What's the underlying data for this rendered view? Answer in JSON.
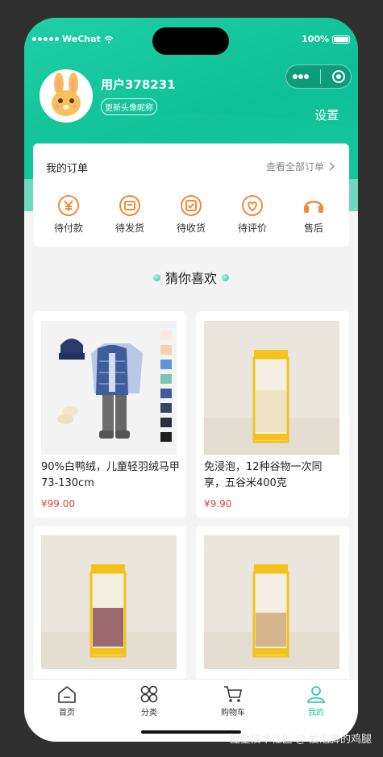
{
  "status_bar": {
    "carrier": "WeChat",
    "battery": "100%"
  },
  "profile": {
    "username": "用户378231",
    "update_label": "更新头像昵称",
    "settings_label": "设置"
  },
  "orders": {
    "title": "我的订单",
    "view_all": "查看全部订单",
    "items": [
      {
        "label": "待付款",
        "icon": "yen-circle-icon"
      },
      {
        "label": "待发货",
        "icon": "shipping-box-icon"
      },
      {
        "label": "待收货",
        "icon": "receive-check-icon"
      },
      {
        "label": "待评价",
        "icon": "heart-comment-icon"
      },
      {
        "label": "售后",
        "icon": "headset-icon"
      }
    ]
  },
  "recommend": {
    "title": "猜你喜欢"
  },
  "products": [
    {
      "title": "90%白鸭绒，儿童轻羽绒马甲73-130cm",
      "price": "¥99.00"
    },
    {
      "title": "免浸泡，12种谷物一次同享，五谷米400克",
      "price": "¥9.90"
    },
    {
      "title": "",
      "price": ""
    },
    {
      "title": "",
      "price": ""
    }
  ],
  "tabbar": [
    {
      "label": "首页",
      "icon": "home-icon"
    },
    {
      "label": "分类",
      "icon": "category-icon"
    },
    {
      "label": "购物车",
      "icon": "cart-icon"
    },
    {
      "label": "我的",
      "icon": "user-icon"
    }
  ],
  "colors": {
    "primary": "#1fc39b",
    "price": "#e0443a",
    "order_icon": "#f08a3c"
  },
  "watermark": "掘金技术社区 @ 爱泡脚的鸡腿"
}
